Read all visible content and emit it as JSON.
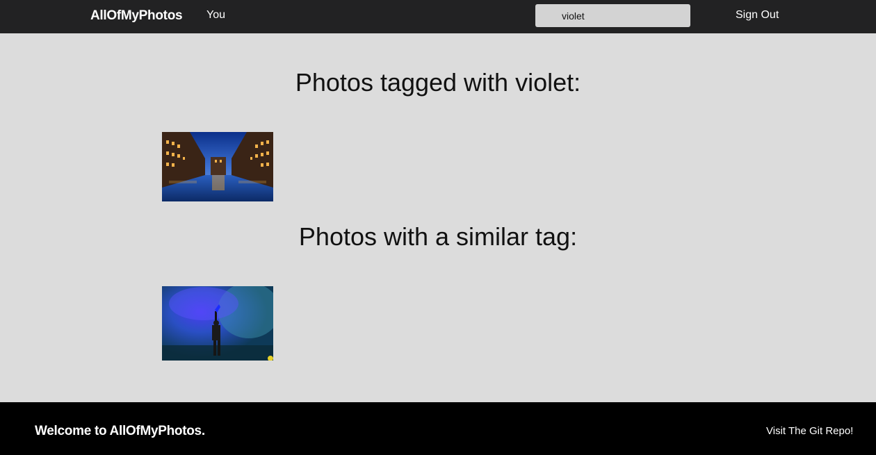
{
  "navbar": {
    "brand": "AllOfMyPhotos",
    "you_link": "You",
    "search_value": "violet",
    "signout": "Sign Out"
  },
  "main": {
    "tagged_heading": "Photos tagged with violet:",
    "similar_heading": "Photos with a similar tag:"
  },
  "footer": {
    "welcome": "Welcome to AllOfMyPhotos.",
    "git_link": "Visit The Git Repo!"
  }
}
